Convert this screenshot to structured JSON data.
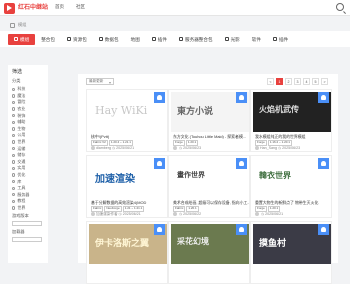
{
  "header": {
    "logo_text": "红石中继站",
    "nav": [
      "首页",
      "社区"
    ]
  },
  "breadcrumb": {
    "current": "模组"
  },
  "categories": [
    "模组",
    "整合包",
    "资源包",
    "数据包",
    "光影",
    "地图",
    "插件",
    "服务器整合包",
    "光影",
    "软件",
    "插件"
  ],
  "sidebar": {
    "title": "筛选",
    "group": "分类",
    "items": [
      "科技",
      "魔法",
      "冒险",
      "农业",
      "装饰",
      "辅助",
      "生物",
      "公用",
      "世界",
      "运输",
      "储存",
      "交通",
      "实用",
      "优化",
      "库",
      "工具",
      "服务器",
      "教程",
      "世界"
    ],
    "sub1": "游戏版本",
    "sub2": "加载器"
  },
  "toolbar": {
    "sort": "最新更新",
    "pages": [
      "<",
      "1",
      "2",
      "3",
      "4",
      "5",
      ">"
    ],
    "current_page": "1"
  },
  "cards": [
    {
      "thumb_text": "Hay WiKi",
      "title": "核中!(Pvtt)",
      "tags": [
        "Fabric V2",
        "1.20.4 ~ 1.21.1"
      ],
      "author": "dlamberg",
      "date": "2025/06/21"
    },
    {
      "thumb_text": "東方小说",
      "title": "东方文化 (Touhou Little Maid) - 探索者模...",
      "tags": [
        "Forge",
        "1.20.1"
      ],
      "author": "",
      "date": "2025/06/23"
    },
    {
      "thumb_text": "火焰机武传",
      "title": "我水模组纯正的我的世界模组",
      "tags": [
        "Forge",
        "1.16.2 ~ 1.20.1"
      ],
      "author": "Han_Sang",
      "date": "2025/06/23"
    },
    {
      "thumb_text": "加速渲染",
      "title": "基于分解数据的高效渲染4(MOD",
      "tags": [
        "Fabric",
        "NeoForge",
        "1.21 ~ 1.21.1"
      ],
      "author": "加速渲染作者",
      "date": "2025/06/21"
    },
    {
      "thumb_text": "畫作世界",
      "title": "美术合成绘画, 超级可以保存设备, 指向小工...",
      "tags": [
        "Fabric",
        "1.20.1"
      ],
      "author": "",
      "date": "2025/06/22"
    },
    {
      "thumb_text": "韓衣世界",
      "title": "重置大物生的新鲜点了 物带生灭火化",
      "tags": [
        "Forge",
        "1.20.1"
      ],
      "author": "",
      "date": "2025/06/21"
    },
    {
      "thumb_text": "伊卡洛斯之翼",
      "title": "",
      "tags": [],
      "author": "",
      "date": ""
    },
    {
      "thumb_text": "采花幻境",
      "title": "",
      "tags": [],
      "author": "",
      "date": ""
    },
    {
      "thumb_text": "摸鱼村",
      "title": "",
      "tags": [],
      "author": "",
      "date": ""
    }
  ],
  "colors": {
    "accent": "#e8413e",
    "badge": "#4a8ff7"
  }
}
